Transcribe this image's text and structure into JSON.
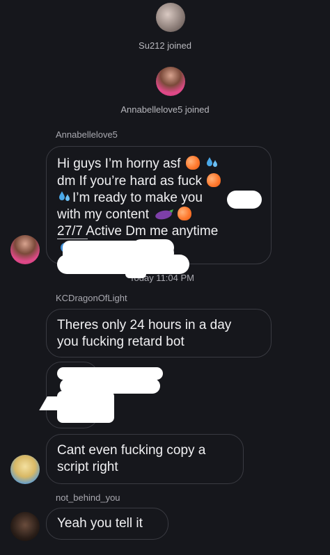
{
  "system": [
    {
      "text": "Su212 joined"
    },
    {
      "text": "Annabellelove5 joined"
    }
  ],
  "messages": {
    "annabelle": {
      "sender": "Annabellelove5",
      "lines": [
        "Hi guys I’m horny asf",
        "dm If you’re hard as fuck",
        "I’m ready to make you",
        "with my content",
        "27/7 Active Dm me anytime"
      ]
    },
    "timestamp": "Today 11:04 PM",
    "kc": {
      "sender": "KCDragonOfLight",
      "lines": [
        "Theres only 24 hours in a day",
        "you fucking retard bot"
      ],
      "lines2": [
        "Cant even fucking copy a",
        "script right"
      ]
    },
    "nb": {
      "sender": "not_behind_you",
      "lines": [
        "Yeah you tell it"
      ]
    }
  },
  "icons": {
    "peach": "peach-emoji",
    "drops": "sweat-droplets-emoji",
    "eggplant": "eggplant-emoji"
  }
}
